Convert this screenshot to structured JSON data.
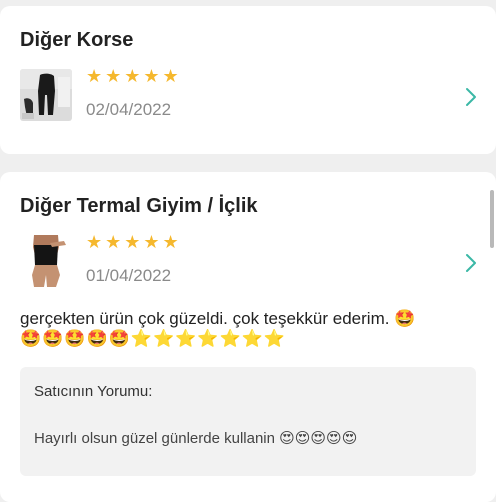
{
  "reviews": [
    {
      "category": "Diğer Korse",
      "rating": 5,
      "stars": "★★★★★",
      "date": "02/04/2022"
    },
    {
      "category": "Diğer Termal Giyim / İçlik",
      "rating": 5,
      "stars": "★★★★★",
      "date": "01/04/2022",
      "text": "gerçekten ürün çok güzeldi. çok teşekkür ederim. 🤩",
      "text_emoji_line": "🤩🤩🤩🤩🤩⭐⭐⭐⭐⭐⭐⭐",
      "seller_label": "Satıcının Yorumu:",
      "seller_reply": "Hayırlı olsun güzel günlerde kullanin 😍😍😍😍😍"
    }
  ],
  "colors": {
    "star": "#f5b82e",
    "chevron": "#3bb8a6",
    "background": "#efefef",
    "card": "#ffffff",
    "seller_box": "#f2f2f2"
  },
  "icons": [
    "chevron-right-icon"
  ]
}
